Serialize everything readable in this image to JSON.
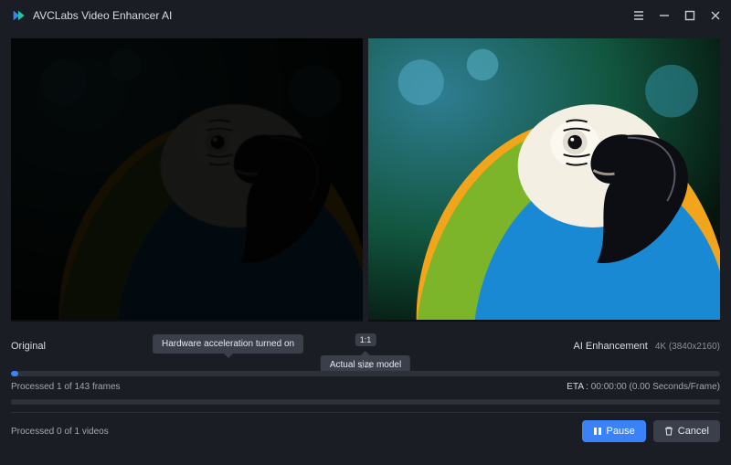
{
  "app": {
    "title": "AVCLabs Video Enhancer AI"
  },
  "preview": {
    "left_label": "Original",
    "right_label": "AI Enhancement",
    "resolution": "4K (3840x2160)",
    "ratio_badge": "1:1"
  },
  "tooltips": {
    "hardware": "Hardware acceleration turned on",
    "actual_size": "Actual size model"
  },
  "progress": {
    "frames_pct_label": "0%",
    "frames_status": "Processed 1 of 143 frames",
    "eta_label": "ETA :",
    "eta_value": "00:00:00 (0.00 Seconds/Frame)",
    "videos_status": "Processed 0 of 1 videos"
  },
  "buttons": {
    "pause": "Pause",
    "cancel": "Cancel"
  }
}
